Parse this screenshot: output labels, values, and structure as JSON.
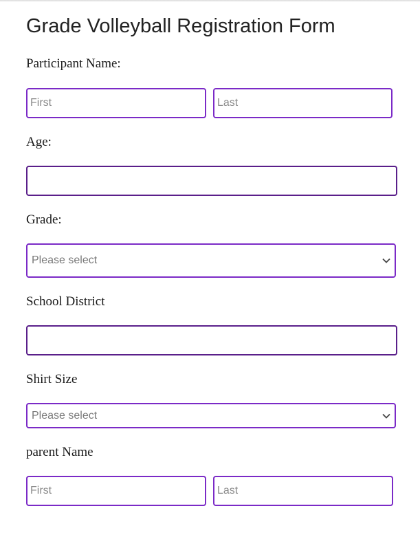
{
  "form": {
    "title": "Grade Volleyball Registration Form",
    "participant_name": {
      "label": "Participant Name:",
      "first_placeholder": "First",
      "last_placeholder": "Last"
    },
    "age": {
      "label": "Age:",
      "value": ""
    },
    "grade": {
      "label": "Grade:",
      "selected": "Please select"
    },
    "school_district": {
      "label": "School District",
      "value": ""
    },
    "shirt_size": {
      "label": "Shirt Size",
      "selected": "Please select"
    },
    "parent_name": {
      "label": "parent Name",
      "first_placeholder": "First",
      "last_placeholder": "Last"
    }
  },
  "colors": {
    "field_border": "#7b2ac7",
    "field_border_dark": "#5a1f8a",
    "placeholder": "#8a8a8a"
  },
  "icons": {
    "select_indicator": "chevron-down-icon"
  }
}
